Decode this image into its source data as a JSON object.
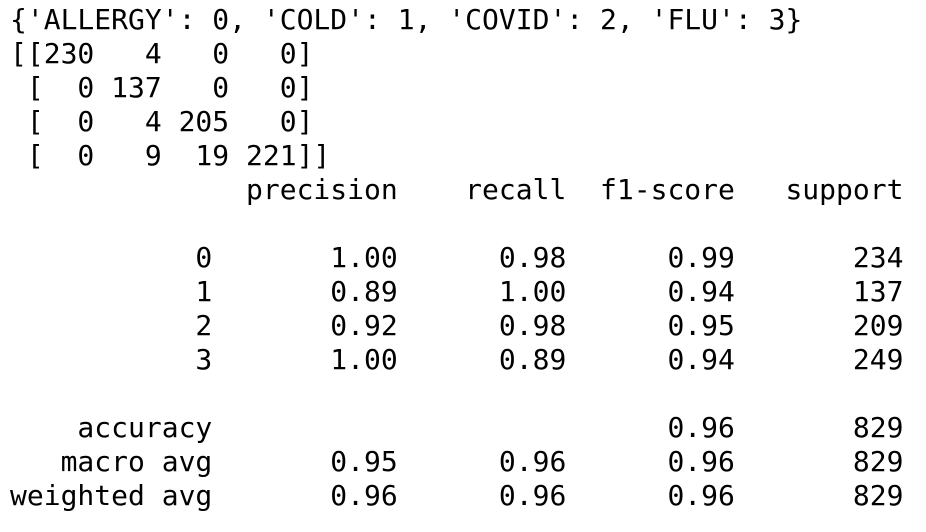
{
  "terminal": {
    "label_mapping": "{'ALLERGY': 0, 'COLD': 1, 'COVID': 2, 'FLU': 3}",
    "confusion_matrix": [
      "[[230   4   0   0]",
      " [  0 137   0   0]",
      " [  0   4 205   0]",
      " [  0   9  19 221]]"
    ],
    "report_header": "              precision    recall  f1-score   support",
    "report_rows": [
      "",
      "           0       1.00      0.98      0.99       234",
      "           1       0.89      1.00      0.94       137",
      "           2       0.92      0.98      0.95       209",
      "           3       1.00      0.89      0.94       249",
      "",
      "    accuracy                           0.96       829",
      "   macro avg       0.95      0.96      0.96       829",
      "weighted avg       0.96      0.96      0.96       829"
    ]
  }
}
